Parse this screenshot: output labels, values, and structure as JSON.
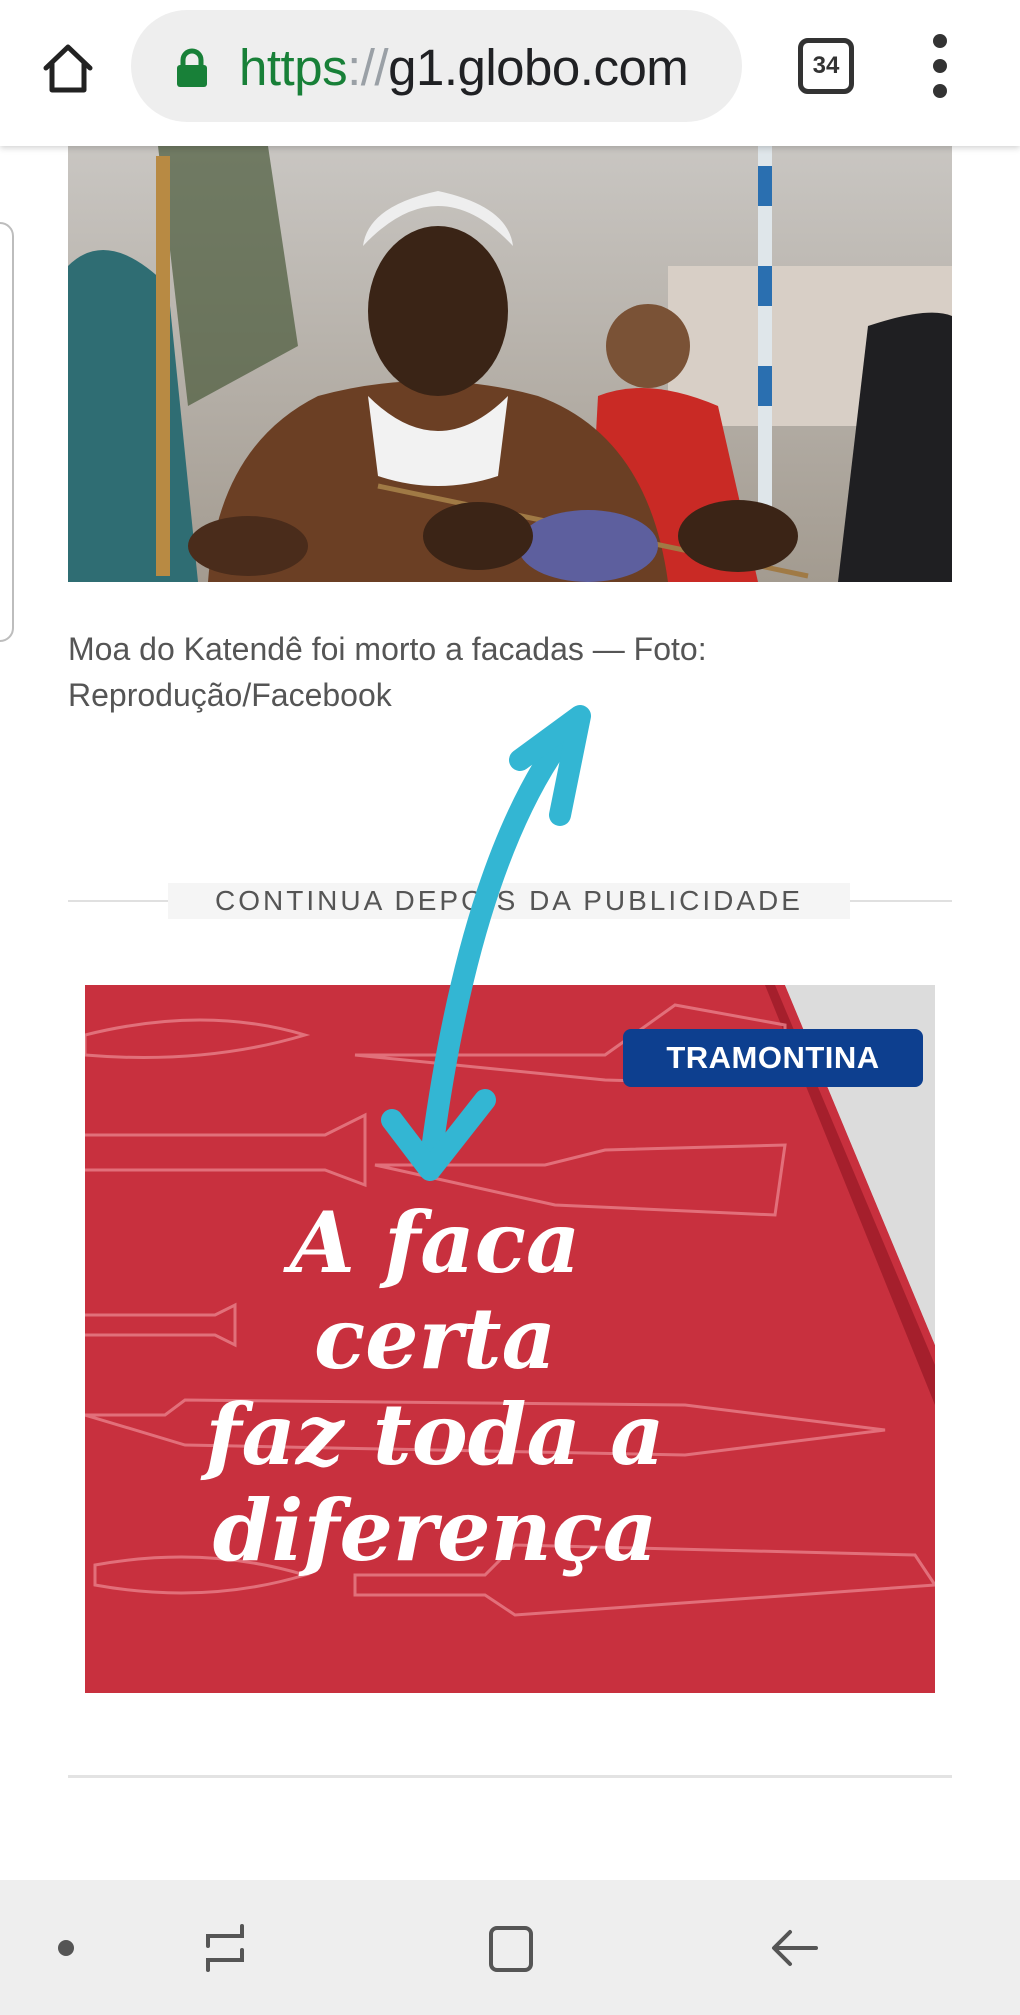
{
  "browser": {
    "url_scheme": "https",
    "url_separator": "://",
    "url_host": "g1.globo.com",
    "tab_count": "34",
    "icons": {
      "home": "home-icon",
      "lock": "lock-icon",
      "menu": "more-vert-icon"
    },
    "colors": {
      "secure_green": "#188038",
      "url_text": "#202124"
    }
  },
  "article": {
    "caption": "Moa do Katendê foi morto a facadas — Foto: Reprodução/Facebook",
    "ad_separator_label": "CONTINUA DEPOIS DA PUBLICIDADE"
  },
  "advert": {
    "brand": "TRAMONTINA",
    "headline_lines": [
      "A faca certa",
      "faz toda a",
      "diferença"
    ],
    "colors": {
      "background": "#c8303e",
      "brand_badge": "#0d3f8f"
    }
  },
  "annotation": {
    "arrow_color": "#33b6d3"
  },
  "navbar": {
    "icons": [
      "dot-icon",
      "recent-apps-icon",
      "home-square-icon",
      "back-arrow-icon"
    ]
  }
}
